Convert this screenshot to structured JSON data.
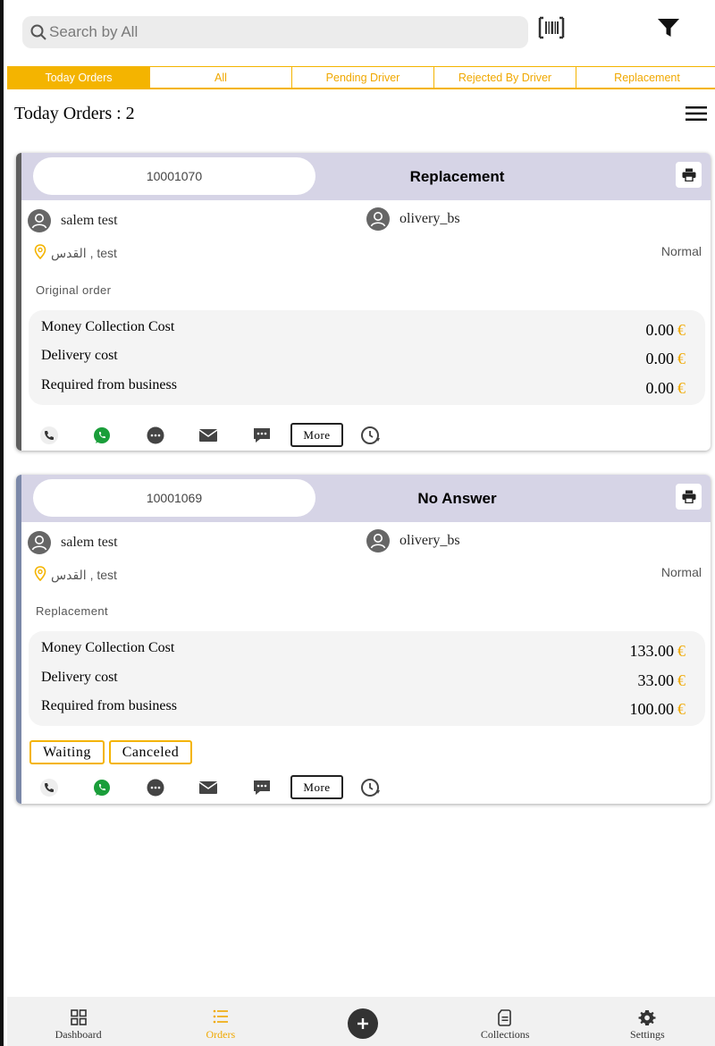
{
  "search": {
    "placeholder": "Search by All"
  },
  "tabs": [
    {
      "label": "Today Orders",
      "active": true
    },
    {
      "label": "All",
      "active": false
    },
    {
      "label": "Pending Driver",
      "active": false
    },
    {
      "label": "Rejected By Driver",
      "active": false
    },
    {
      "label": "Replacement",
      "active": false
    }
  ],
  "orders_heading": "Today Orders : 2",
  "orders": [
    {
      "id": "10001070",
      "status": "Replacement",
      "customer": "salem test",
      "driver": "olivery_bs",
      "address": "القدس , test",
      "priority": "Normal",
      "note": "Original order",
      "costs": [
        {
          "label": "Money Collection Cost",
          "value": "0.00",
          "currency": "€"
        },
        {
          "label": "Delivery cost",
          "value": "0.00",
          "currency": "€"
        },
        {
          "label": "Required from business",
          "value": "0.00",
          "currency": "€"
        }
      ],
      "chips": [],
      "more_label": "More",
      "stripe_color": "#5e5e5e"
    },
    {
      "id": "10001069",
      "status": "No Answer",
      "customer": "salem test",
      "driver": "olivery_bs",
      "address": "القدس , test",
      "priority": "Normal",
      "note": "Replacement",
      "costs": [
        {
          "label": "Money Collection Cost",
          "value": "133.00",
          "currency": "€"
        },
        {
          "label": "Delivery cost",
          "value": "33.00",
          "currency": "€"
        },
        {
          "label": "Required from business",
          "value": "100.00",
          "currency": "€"
        }
      ],
      "chips": [
        "Waiting",
        "Canceled"
      ],
      "more_label": "More",
      "stripe_color": "#7b88a8"
    }
  ],
  "bottom_nav": [
    {
      "label": "Dashboard",
      "icon": "dashboard-icon",
      "active": false
    },
    {
      "label": "Orders",
      "icon": "list-icon",
      "active": true
    },
    {
      "label": "",
      "icon": "plus-icon",
      "active": false
    },
    {
      "label": "Collections",
      "icon": "document-icon",
      "active": false
    },
    {
      "label": "Settings",
      "icon": "gear-icon",
      "active": false
    }
  ],
  "colors": {
    "accent": "#f4b400",
    "header_bg": "#d6d4e6",
    "whatsapp": "#1a9e3a"
  }
}
